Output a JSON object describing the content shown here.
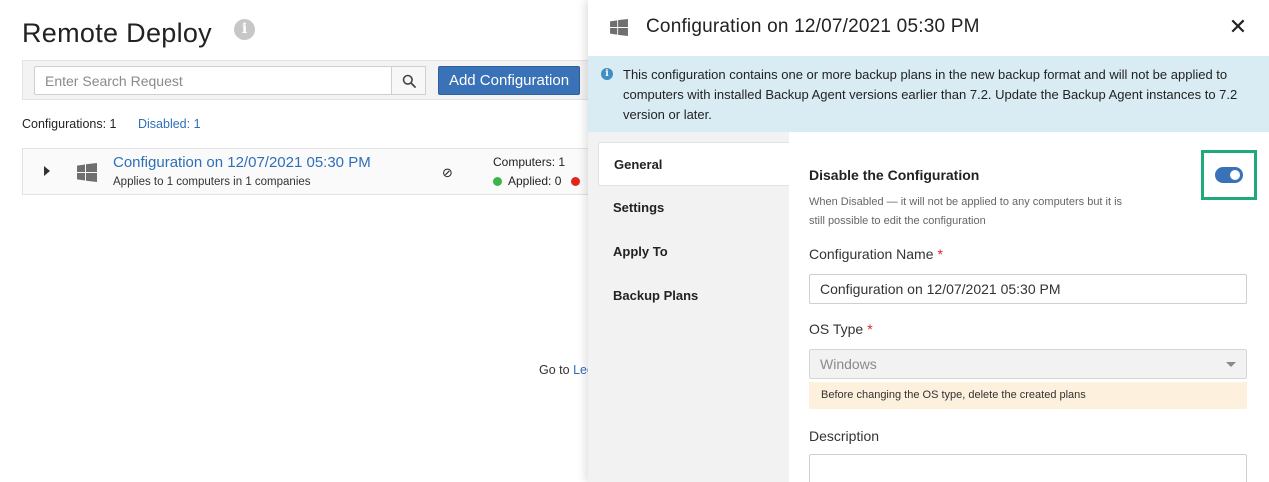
{
  "page": {
    "title": "Remote Deploy",
    "info_icon": "info-icon"
  },
  "toolbar": {
    "search_placeholder": "Enter Search Request",
    "search_icon": "search-icon",
    "add_button": "Add Configuration"
  },
  "stats": {
    "configurations": "Configurations: 1",
    "disabled": "Disabled: 1"
  },
  "configurations": [
    {
      "name": "Configuration on 12/07/2021 05:30 PM",
      "subtitle": "Applies to 1 computers in 1 companies",
      "os_icon": "windows-icon",
      "status_icon": "disabled-icon",
      "computers": "Computers: 1",
      "applied": "Applied: 0"
    }
  ],
  "footer": {
    "go_to": "Go to",
    "legacy_link": "Leg"
  },
  "panel": {
    "title": "Configuration on 12/07/2021 05:30 PM",
    "close_symbol": "✕",
    "notice": "This configuration contains one or more backup plans in the new backup format and will not be applied to computers with installed Backup Agent versions earlier than 7.2. Update the Backup Agent instances to 7.2 version or later.",
    "tabs": [
      "General",
      "Settings",
      "Apply To",
      "Backup Plans"
    ],
    "active_tab": "General",
    "form": {
      "disable_title": "Disable the Configuration",
      "disable_desc": "When Disabled — it will not be applied to any computers but it is still possible to edit the configuration",
      "disable_toggle_on": true,
      "name_label": "Configuration Name",
      "name_value": "Configuration on 12/07/2021 05:30 PM",
      "os_label": "OS Type",
      "os_value": "Windows",
      "os_warning": "Before changing the OS type, delete the created plans",
      "description_label": "Description",
      "description_value": "",
      "required_mark": "*"
    }
  },
  "colors": {
    "accent": "#3a72b7",
    "link": "#2f6fb7",
    "notice_bg": "#d9ecf3",
    "warning_bg": "#fdf0dc",
    "highlight_frame": "#1eaa7c",
    "applied_dot": "#3ab54a",
    "failed_dot": "#e0261b"
  }
}
